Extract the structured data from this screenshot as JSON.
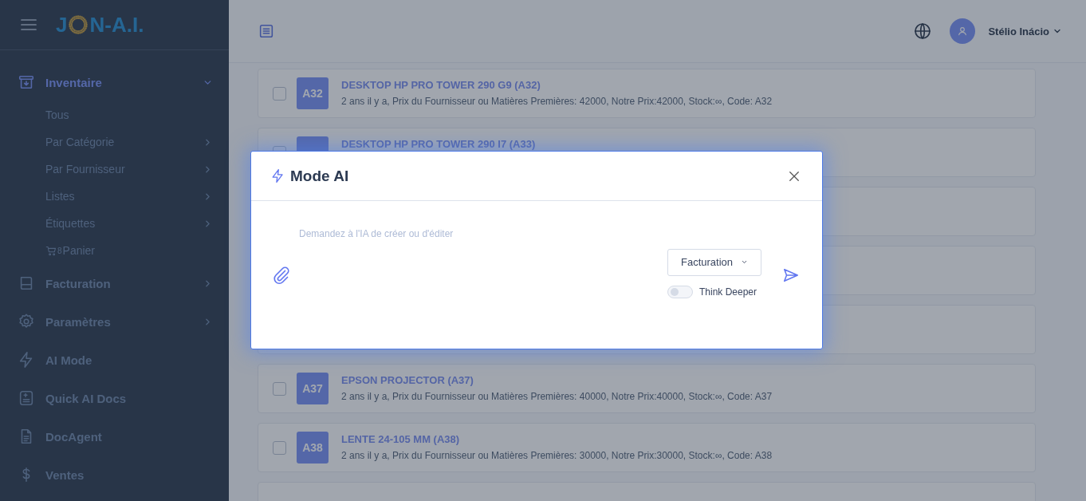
{
  "sidebar": {
    "logo": {
      "before": "J",
      "after": "N-A.I."
    },
    "items": [
      {
        "label": "Inventaire",
        "selected": true,
        "expanded": true,
        "has_children": true,
        "children": [
          {
            "label": "Tous",
            "has_children": false
          },
          {
            "label": "Par Catégorie",
            "has_children": true
          },
          {
            "label": "Par Fournisseur",
            "has_children": true
          },
          {
            "label": "Listes",
            "has_children": true
          },
          {
            "label": "Étiquettes",
            "has_children": true
          },
          {
            "label": "Panier",
            "has_children": false,
            "count": "8"
          }
        ]
      },
      {
        "label": "Facturation",
        "selected": false,
        "expanded": false,
        "has_children": true
      },
      {
        "label": "Paramètres",
        "selected": false,
        "expanded": false,
        "has_children": true
      },
      {
        "label": "AI Mode",
        "selected": false,
        "has_children": false
      },
      {
        "label": "Quick AI Docs",
        "selected": false,
        "has_children": false
      },
      {
        "label": "DocAgent",
        "selected": false,
        "has_children": false
      },
      {
        "label": "Ventes",
        "selected": false,
        "has_children": false
      }
    ]
  },
  "topbar": {
    "user": "Stélio Inácio"
  },
  "rows_above_dialog": [
    {
      "badge": "A32",
      "title": "DESKTOP HP PRO TOWER 290 G9 (A32)",
      "details": "2 ans il y a, Prix du Fournisseur ou Matières Premières: 42000, Notre Prix:42000, Stock:∞, Code: A32",
      "checked": false
    },
    {
      "title": "DESKTOP HP PRO TOWER 290 I7 (A33)"
    }
  ],
  "rows_below_dialog": [
    {
      "badge": "A37",
      "title": "EPSON PROJECTOR (A37)",
      "details": "2 ans il y a, Prix du Fournisseur ou Matières Premières: 40000, Notre Prix:40000, Stock:∞, Code: A37",
      "checked": false
    },
    {
      "badge": "A38",
      "title": "LENTE 24-105 MM (A38)",
      "details": "2 ans il y a, Prix du Fournisseur ou Matières Premières: 30000, Notre Prix:30000, Stock:∞, Code: A38",
      "checked": false
    }
  ],
  "modal": {
    "title": "Mode AI",
    "placeholder": "Demandez à l'IA de créer ou d'éditer",
    "mode": "Facturation",
    "toggle": {
      "label": "Think Deeper",
      "on": false
    }
  }
}
